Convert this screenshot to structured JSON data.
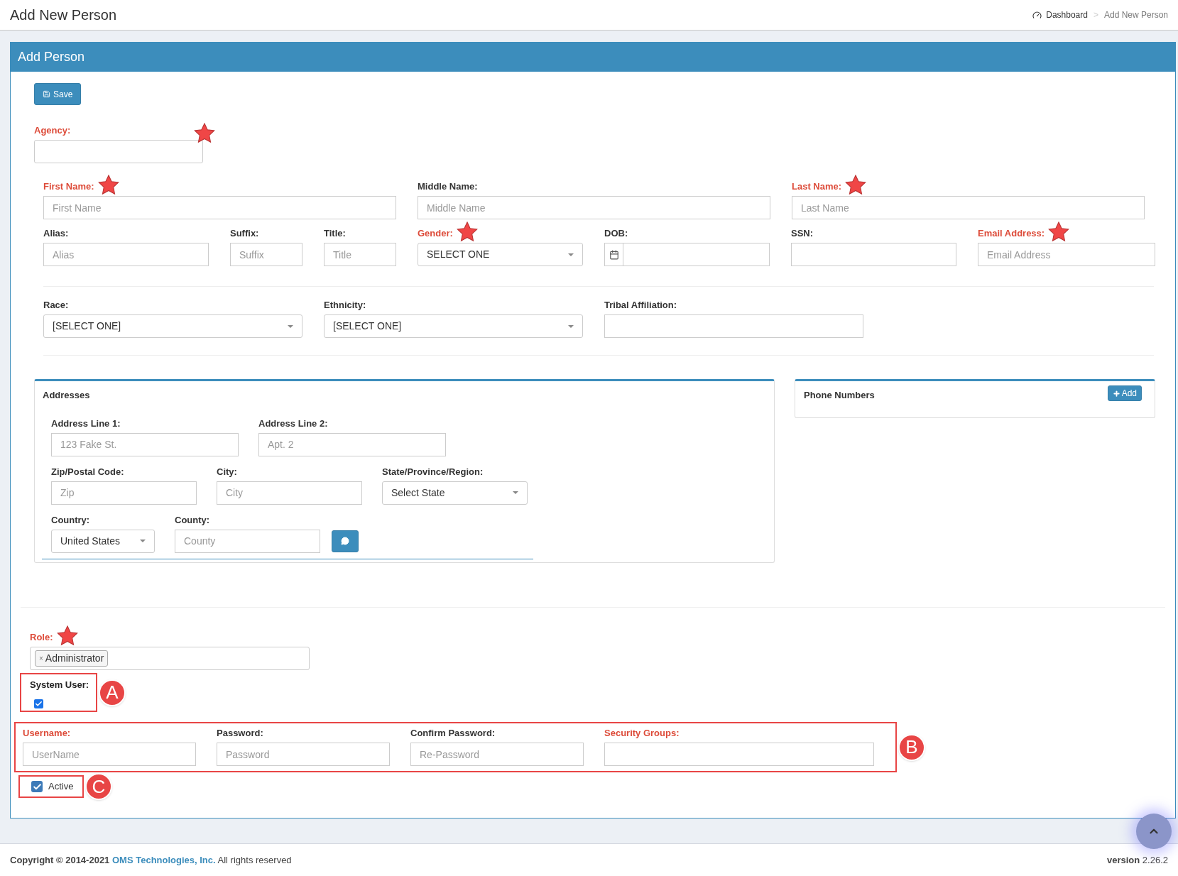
{
  "header": {
    "title": "Add New Person",
    "separator": ">",
    "breadcrumb": [
      {
        "label": "Dashboard",
        "kind": "link"
      },
      {
        "label": "Add New Person",
        "kind": "current"
      }
    ]
  },
  "panel": {
    "title": "Add Person",
    "save_button": "Save",
    "agency": {
      "label": "Agency:",
      "required": true,
      "starred": true
    },
    "rows": [
      {
        "fields": [
          {
            "label": "First Name:",
            "placeholder": "First Name",
            "kind": "text",
            "required": true,
            "starred": true
          },
          {
            "label": "Middle Name:",
            "placeholder": "Middle Name",
            "kind": "text",
            "required": false,
            "starred": false
          },
          {
            "label": "Last Name:",
            "placeholder": "Last Name",
            "kind": "text",
            "required": true,
            "starred": true
          }
        ]
      },
      {
        "fields": [
          {
            "label": "Alias:",
            "placeholder": "Alias",
            "kind": "text",
            "required": false,
            "starred": false
          },
          {
            "label": "Suffix:",
            "placeholder": "Suffix",
            "kind": "text",
            "required": false,
            "starred": false
          },
          {
            "label": "Title:",
            "placeholder": "Title",
            "kind": "text",
            "required": false,
            "starred": false
          },
          {
            "label": "Gender:",
            "value": "SELECT ONE",
            "kind": "select",
            "required": true,
            "starred": true
          },
          {
            "label": "DOB:",
            "kind": "date",
            "required": false,
            "starred": false
          },
          {
            "label": "SSN:",
            "kind": "text",
            "required": false,
            "starred": false
          },
          {
            "label": "Email Address:",
            "placeholder": "Email Address",
            "kind": "text",
            "required": true,
            "starred": true
          }
        ]
      },
      {
        "fields": [
          {
            "label": "Race:",
            "value": "[SELECT ONE]",
            "kind": "select",
            "required": false,
            "starred": false
          },
          {
            "label": "Ethnicity:",
            "value": "[SELECT ONE]",
            "kind": "select",
            "required": false,
            "starred": false
          },
          {
            "label": "Tribal Affiliation:",
            "kind": "text",
            "required": false,
            "starred": false
          }
        ]
      }
    ],
    "addresses": {
      "title": "Addresses",
      "rows": [
        {
          "fields": [
            {
              "label": "Address Line 1:",
              "placeholder": "123 Fake St.",
              "kind": "text",
              "required": false,
              "starred": false
            },
            {
              "label": "Address Line 2:",
              "placeholder": "Apt. 2",
              "kind": "text",
              "required": false,
              "starred": false
            }
          ]
        },
        {
          "fields": [
            {
              "label": "Zip/Postal Code:",
              "placeholder": "Zip",
              "kind": "text",
              "required": false,
              "starred": false
            },
            {
              "label": "City:",
              "placeholder": "City",
              "kind": "text",
              "required": false,
              "starred": false
            },
            {
              "label": "State/Province/Region:",
              "value": "Select State",
              "kind": "select",
              "required": false,
              "starred": false
            }
          ]
        },
        {
          "fields": [
            {
              "label": "Country:",
              "value": "United States",
              "kind": "select",
              "required": false,
              "starred": false
            },
            {
              "label": "County:",
              "placeholder": "County",
              "kind": "text",
              "required": false,
              "starred": false
            }
          ]
        }
      ]
    },
    "phone_numbers": {
      "title": "Phone Numbers",
      "add_button": "Add"
    },
    "role": {
      "label": "Role:",
      "required": true,
      "starred": true,
      "remove_symbol": "×",
      "tags": [
        "Administrator"
      ]
    },
    "system_user": {
      "label": "System User:",
      "checked": true,
      "callout": "A"
    },
    "account": {
      "callout": "B",
      "fields": [
        {
          "label": "Username:",
          "placeholder": "UserName",
          "kind": "text",
          "required": true,
          "starred": false
        },
        {
          "label": "Password:",
          "placeholder": "Password",
          "kind": "text",
          "required": false,
          "starred": false
        },
        {
          "label": "Confirm Password:",
          "placeholder": "Re-Password",
          "kind": "text",
          "required": false,
          "starred": false
        },
        {
          "label": "Security Groups:",
          "kind": "text",
          "required": true,
          "starred": false
        }
      ]
    },
    "active": {
      "label": "Active",
      "checked": true,
      "callout": "C"
    }
  },
  "footer": {
    "copyright": "Copyright © 2014-2021",
    "company": "OMS Technologies, Inc.",
    "rights": "All rights reserved",
    "version_label": "version",
    "version": "2.26.2"
  }
}
